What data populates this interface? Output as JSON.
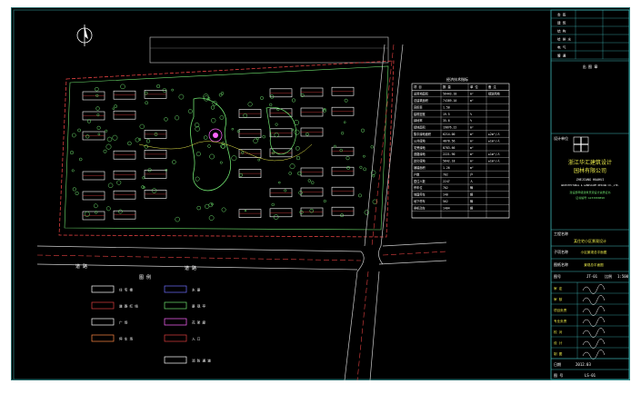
{
  "drawing": {
    "north_symbol": "N",
    "legend_title": "图 例",
    "road_labels": [
      "道 路",
      "道 路"
    ],
    "table": {
      "title": "经济技术指标",
      "headers": [
        "项 目",
        "数 量",
        "单 位",
        "备 注"
      ],
      "rows": [
        [
          "总用地面积",
          "56443.18",
          "m²",
          "规划用地"
        ],
        [
          "总建筑面积",
          "74389.10",
          "m²",
          ""
        ],
        [
          "容积率",
          "1.50",
          "",
          ""
        ],
        [
          "建筑密度",
          "19.5",
          "%",
          ""
        ],
        [
          "绿地率",
          "35.6",
          "%",
          ""
        ],
        [
          "绿地面积",
          "19876.22",
          "m²",
          ""
        ],
        [
          "集中绿地面积",
          "6214.00",
          "m²",
          "≥2m²/人"
        ],
        [
          "公共绿地",
          "4878.56",
          "m²",
          "≥1m²/人"
        ],
        [
          "宅旁绿地",
          "8783.66",
          "m²",
          ""
        ],
        [
          "道路绿地",
          "2221.90",
          "m²",
          "≥1m²/人"
        ],
        [
          "其它绿地",
          "5842.18",
          "m²",
          "≥1m²/人"
        ],
        [
          "铺装面积",
          "1.26",
          "m²",
          ""
        ],
        [
          "户数",
          "702",
          "户",
          ""
        ],
        [
          "居住人数",
          "2247",
          "人",
          ""
        ],
        [
          "停车位",
          "702",
          "辆",
          ""
        ],
        [
          "地面停车",
          "140",
          "辆",
          ""
        ],
        [
          "地下停车",
          "562",
          "辆",
          ""
        ],
        [
          "非机动车",
          "1404",
          "辆",
          ""
        ],
        [
          "",
          "",
          "",
          ""
        ]
      ]
    },
    "legend_items": [
      {
        "label": "住 宅 楼"
      },
      {
        "label": "道 路 红 线"
      },
      {
        "label": "广 场"
      },
      {
        "label": "停 车 场"
      },
      {
        "label": "水 景"
      },
      {
        "label": "景 观 亭"
      },
      {
        "label": "花 架 廊"
      },
      {
        "label": "入 口"
      },
      {
        "label": "消 防 通 道"
      }
    ]
  },
  "title_block": {
    "header_rows": [
      "会 签",
      "建 筑",
      "结 构",
      "给 排 水",
      "电 气",
      "暖 通"
    ],
    "stamp_label": "出 图 章",
    "company_label": "设计单位",
    "company_name_line1": "浙江华汇建筑设计",
    "company_name_line2": "园林有限公司",
    "company_name_en1": "ZHEJIANG HUAHUI",
    "company_name_en2": "ARCHITECTURAL & LANDSCAPE DESIGN CO.,LTD.",
    "license_line1": "建设部甲级建筑景观设计资质证书",
    "license_line2": "证书编号:A233000898",
    "project_label": "工程名称",
    "project_name": "某住宅小区景观设计",
    "subproject_label": "子项名称",
    "subproject_name": "小区景观总平面图",
    "drawing_label": "图纸名称",
    "drawing_name": "景观总平面图",
    "number_label": "图号",
    "number_value": "JT-01",
    "scale_label": "比例",
    "scale_value": "1:500",
    "sign_rows": [
      "审 定",
      "审 核",
      "项目负责",
      "专业负责",
      "校 对",
      "设 计",
      "制 图"
    ],
    "date_label": "日期",
    "date_value": "2012.03",
    "sheet_label": "图 号",
    "sheet_value": "LS-01"
  }
}
